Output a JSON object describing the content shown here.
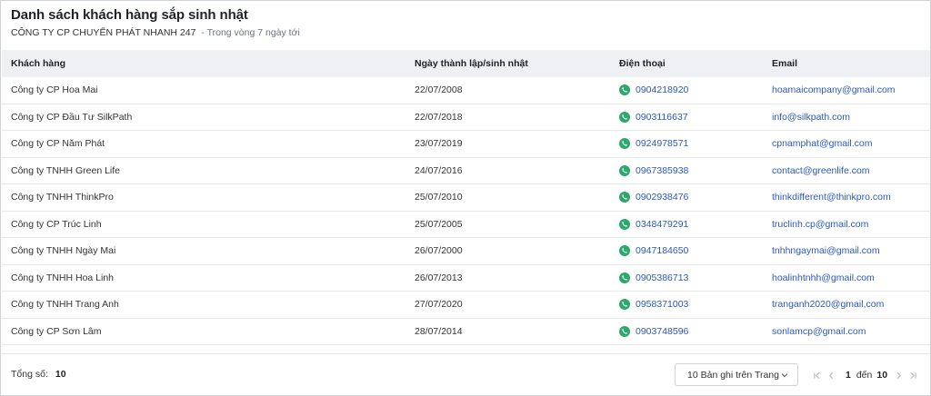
{
  "header": {
    "title": "Danh sách khách hàng sắp sinh nhật",
    "company": "CÔNG TY CP CHUYỂN PHÁT NHANH 247",
    "range": "- Trong vòng 7 ngày tới"
  },
  "table": {
    "columns": [
      "Khách hàng",
      "Ngày thành lập/sinh nhật",
      "Điện thoại",
      "Email"
    ],
    "rows": [
      {
        "name": "Công ty CP Hoa Mai",
        "date": "22/07/2008",
        "phone": "0904218920",
        "email": "hoamaicompany@gmail.com"
      },
      {
        "name": "Công ty CP Đầu Tư SilkPath",
        "date": "22/07/2018",
        "phone": "0903116637",
        "email": "info@silkpath.com"
      },
      {
        "name": "Công ty CP Năm Phát",
        "date": "23/07/2019",
        "phone": "0924978571",
        "email": "cpnamphat@gmail.com"
      },
      {
        "name": "Công ty TNHH Green Life",
        "date": "24/07/2016",
        "phone": "0967385938",
        "email": "contact@greenlife.com"
      },
      {
        "name": "Công ty TNHH ThinkPro",
        "date": "25/07/2010",
        "phone": "0902938476",
        "email": "thinkdifferent@thinkpro.com"
      },
      {
        "name": "Công ty CP Trúc Linh",
        "date": "25/07/2005",
        "phone": "0348479291",
        "email": "truclinh.cp@gmail.com"
      },
      {
        "name": "Công ty TNHH Ngày Mai",
        "date": "26/07/2000",
        "phone": "0947184650",
        "email": "tnhhngaymai@gmail.com"
      },
      {
        "name": "Công ty TNHH Hoa Linh",
        "date": "26/07/2013",
        "phone": "0905386713",
        "email": "hoalinhtnhh@gmail.com"
      },
      {
        "name": "Công ty TNHH Trang Anh",
        "date": "27/07/2020",
        "phone": "0958371003",
        "email": "tranganh2020@gmail,com"
      },
      {
        "name": "Công ty CP Sơn Lâm",
        "date": "28/07/2014",
        "phone": "0903748596",
        "email": "sonlamcp@gmail.com"
      }
    ]
  },
  "footer": {
    "total_label": "Tổng số:",
    "total_value": "10",
    "page_size_label": "10 Bản ghi trên Trang",
    "current_page": "1",
    "to_label": "đến",
    "total_pages": "10"
  },
  "colors": {
    "phone_icon": "#2aa96b",
    "link": "#2b58c4",
    "header_bg": "#eef0f3"
  },
  "icons": {
    "phone": "phone-icon",
    "page_size_dropdown": "chevron-down-icon",
    "first_page": "first-page-icon",
    "prev_page": "chevron-left-icon",
    "next_page": "chevron-right-icon",
    "last_page": "last-page-icon"
  }
}
